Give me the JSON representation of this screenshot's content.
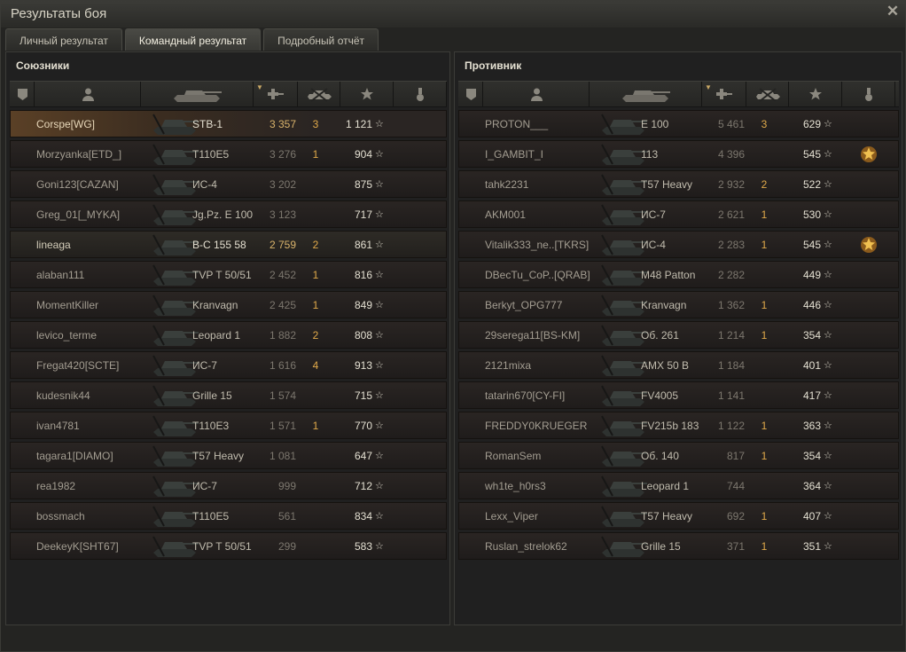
{
  "window": {
    "title": "Результаты боя",
    "close_icon": "close-icon"
  },
  "tabs": [
    {
      "label": "Личный результат",
      "active": false
    },
    {
      "label": "Командный результат",
      "active": true
    },
    {
      "label": "Подробный отчёт",
      "active": false
    }
  ],
  "columns": {
    "squad_icon": "squad-icon",
    "player_icon": "player-icon",
    "tank_icon": "tank-icon",
    "damage_icon": "damage-icon",
    "kills_icon": "kills-icon",
    "xp_icon": "star-icon",
    "medal_icon": "medal-icon",
    "sorted_column": "damage"
  },
  "allies": {
    "title": "Союзники",
    "rows": [
      {
        "player": "Corspe[WG]",
        "tank": "STB-1",
        "damage": "3 357",
        "kills": "3",
        "xp": "1 121",
        "highlight": "self"
      },
      {
        "player": "Morzyanka[ETD_]",
        "tank": "T110E5",
        "damage": "3 276",
        "kills": "1",
        "xp": "904"
      },
      {
        "player": "Goni123[CAZAN]",
        "tank": "ИС-4",
        "damage": "3 202",
        "kills": "",
        "xp": "875"
      },
      {
        "player": "Greg_01[_MYKA]",
        "tank": "Jg.Pz. E 100",
        "damage": "3 123",
        "kills": "",
        "xp": "717"
      },
      {
        "player": "lineaga",
        "tank": "B-C 155 58",
        "damage": "2 759",
        "kills": "2",
        "xp": "861",
        "highlight": "squad"
      },
      {
        "player": "alaban111",
        "tank": "TVP T 50/51",
        "damage": "2 452",
        "kills": "1",
        "xp": "816"
      },
      {
        "player": "MomentKiller",
        "tank": "Kranvagn",
        "damage": "2 425",
        "kills": "1",
        "xp": "849"
      },
      {
        "player": "levico_terme",
        "tank": "Leopard 1",
        "damage": "1 882",
        "kills": "2",
        "xp": "808"
      },
      {
        "player": "Fregat420[SCTE]",
        "tank": "ИС-7",
        "damage": "1 616",
        "kills": "4",
        "xp": "913"
      },
      {
        "player": "kudesnik44",
        "tank": "Grille 15",
        "damage": "1 574",
        "kills": "",
        "xp": "715"
      },
      {
        "player": "ivan4781",
        "tank": "T110E3",
        "damage": "1 571",
        "kills": "1",
        "xp": "770"
      },
      {
        "player": "tagara1[DIAMO]",
        "tank": "T57 Heavy",
        "damage": "1 081",
        "kills": "",
        "xp": "647"
      },
      {
        "player": "rea1982",
        "tank": "ИС-7",
        "damage": "999",
        "kills": "",
        "xp": "712"
      },
      {
        "player": "bossmach",
        "tank": "T110E5",
        "damage": "561",
        "kills": "",
        "xp": "834"
      },
      {
        "player": "DeekeyK[SHT67]",
        "tank": "TVP T 50/51",
        "damage": "299",
        "kills": "",
        "xp": "583"
      }
    ]
  },
  "enemies": {
    "title": "Противник",
    "rows": [
      {
        "player": "PROTON___",
        "tank": "E 100",
        "damage": "5 461",
        "kills": "3",
        "xp": "629"
      },
      {
        "player": "I_GAMBIT_I",
        "tank": "113",
        "damage": "4 396",
        "kills": "",
        "xp": "545",
        "medal": true
      },
      {
        "player": "tahk2231",
        "tank": "T57 Heavy",
        "damage": "2 932",
        "kills": "2",
        "xp": "522"
      },
      {
        "player": "AKM001",
        "tank": "ИС-7",
        "damage": "2 621",
        "kills": "1",
        "xp": "530"
      },
      {
        "player": "Vitalik333_ne..[TKRS]",
        "tank": "ИС-4",
        "damage": "2 283",
        "kills": "1",
        "xp": "545",
        "medal": true
      },
      {
        "player": "DBecTu_CoP..[QRAB]",
        "tank": "M48 Patton",
        "damage": "2 282",
        "kills": "",
        "xp": "449"
      },
      {
        "player": "Berkyt_OPG777",
        "tank": "Kranvagn",
        "damage": "1 362",
        "kills": "1",
        "xp": "446"
      },
      {
        "player": "29serega11[BS-KM]",
        "tank": "Об. 261",
        "damage": "1 214",
        "kills": "1",
        "xp": "354"
      },
      {
        "player": "2121mixa",
        "tank": "AMX 50 B",
        "damage": "1 184",
        "kills": "",
        "xp": "401"
      },
      {
        "player": "tatarin670[CY-FI]",
        "tank": "FV4005",
        "damage": "1 141",
        "kills": "",
        "xp": "417"
      },
      {
        "player": "FREDDY0KRUEGER",
        "tank": "FV215b 183",
        "damage": "1 122",
        "kills": "1",
        "xp": "363"
      },
      {
        "player": "RomanSem",
        "tank": "Об. 140",
        "damage": "817",
        "kills": "1",
        "xp": "354"
      },
      {
        "player": "wh1te_h0rs3",
        "tank": "Leopard 1",
        "damage": "744",
        "kills": "",
        "xp": "364"
      },
      {
        "player": "Lexx_Viper",
        "tank": "T57 Heavy",
        "damage": "692",
        "kills": "1",
        "xp": "407"
      },
      {
        "player": "Ruslan_strelok62",
        "tank": "Grille 15",
        "damage": "371",
        "kills": "1",
        "xp": "351"
      }
    ]
  },
  "colors": {
    "kills": "#e0a94a",
    "self_highlight": "#5a4026",
    "damage_self": "#d9b36b"
  }
}
